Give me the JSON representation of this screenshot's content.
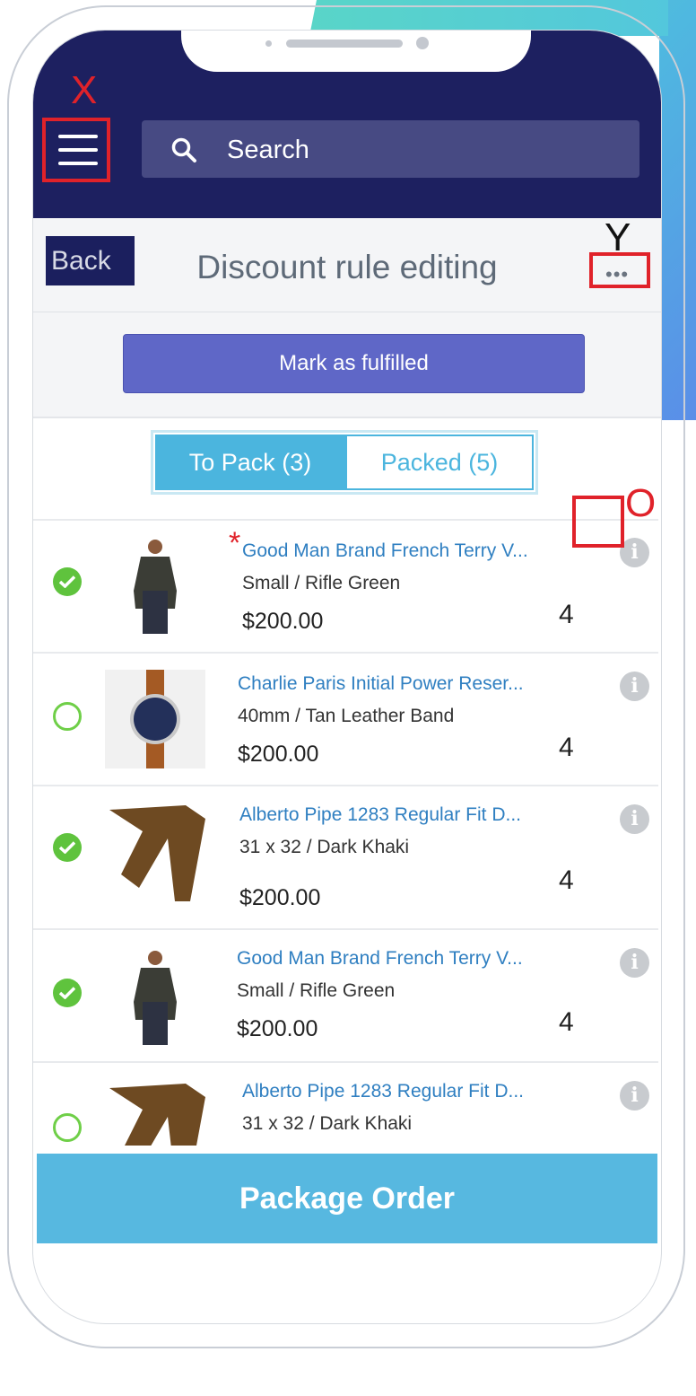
{
  "annotations": {
    "x": "X",
    "y": "Y",
    "o": "O",
    "asterisk": "*"
  },
  "header": {
    "search_label": "Search"
  },
  "toolbar": {
    "back_label": "Back",
    "title": "Discount rule editing",
    "more_label": "•••"
  },
  "actions": {
    "mark_fulfilled": "Mark as fulfilled"
  },
  "tabs": [
    {
      "label": "To Pack (3)",
      "active": true
    },
    {
      "label": "Packed (5)",
      "active": false
    }
  ],
  "items": [
    {
      "name": "Good Man Brand French Terry V...",
      "variant": "Small / Rifle Green",
      "price": "$200.00",
      "qty": "4",
      "checked": true,
      "image": "sweater-man"
    },
    {
      "name": "Charlie Paris Initial Power Reser...",
      "variant": "40mm / Tan Leather Band",
      "price": "$200.00",
      "qty": "4",
      "checked": false,
      "image": "watch"
    },
    {
      "name": "Alberto Pipe 1283 Regular Fit D...",
      "variant": "31 x 32 / Dark Khaki",
      "price": "$200.00",
      "qty": "4",
      "checked": true,
      "image": "pants"
    },
    {
      "name": "Good Man Brand French Terry V...",
      "variant": "Small / Rifle Green",
      "price": "$200.00",
      "qty": "4",
      "checked": true,
      "image": "sweater-man"
    },
    {
      "name": "Alberto Pipe 1283 Regular Fit D...",
      "variant": "31 x 32 / Dark Khaki",
      "price": "",
      "qty": "",
      "checked": false,
      "image": "pants"
    }
  ],
  "footer": {
    "package_order": "Package Order"
  },
  "colors": {
    "navy": "#1d2060",
    "accent": "#57b8e0",
    "primary_button": "#5f67c7",
    "check_green": "#5fc33d",
    "annotation_red": "#e0222a"
  }
}
